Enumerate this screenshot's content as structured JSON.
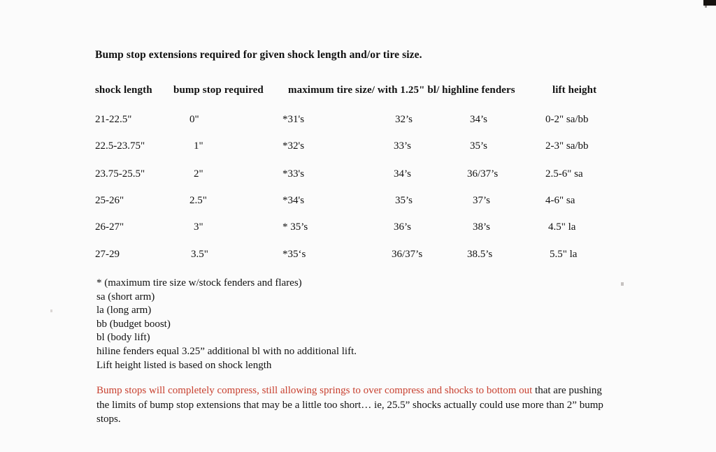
{
  "document": {
    "title": "Bump stop extensions required for given shock length and/or tire size."
  },
  "table": {
    "headers": [
      "shock length",
      "bump stop required",
      "maximum tire size/ with",
      "1.25\" bl/ highline fenders",
      "",
      "lift height"
    ],
    "header_display": {
      "col0": "shock length",
      "col1": "bump stop required",
      "col2": "maximum tire size/ with 1.25\" bl/ highline fenders",
      "col5": "lift height"
    },
    "rows": [
      {
        "shock_length": "21-22.5\"",
        "bump_stop": "0\"",
        "max_tire_stock": "*31's",
        "tire_with_bl": "32’s",
        "tire_highline": "34’s",
        "lift_height": "0-2\" sa/bb"
      },
      {
        "shock_length": "22.5-23.75\"",
        "bump_stop": "1\"",
        "max_tire_stock": "*32's",
        "tire_with_bl": "33’s",
        "tire_highline": "35’s",
        "lift_height": "2-3\" sa/bb"
      },
      {
        "shock_length": "23.75-25.5\"",
        "bump_stop": "2\"",
        "max_tire_stock": "*33's",
        "tire_with_bl": "34’s",
        "tire_highline": "36/37’s",
        "lift_height": "2.5-6\" sa"
      },
      {
        "shock_length": "25-26\"",
        "bump_stop": "2.5\"",
        "max_tire_stock": "*34's",
        "tire_with_bl": "35’s",
        "tire_highline": "37’s",
        "lift_height": "4-6\" sa"
      },
      {
        "shock_length": "26-27\"",
        "bump_stop": "3\"",
        "max_tire_stock": "* 35’s",
        "tire_with_bl": "36’s",
        "tire_highline": "38’s",
        "lift_height": "4.5\" la"
      },
      {
        "shock_length": "27-29",
        "bump_stop": "3.5\"",
        "max_tire_stock": "*35‘s",
        "tire_with_bl": "36/37’s",
        "tire_highline": "38.5’s",
        "lift_height": "5.5\" la"
      }
    ]
  },
  "legend": {
    "lines": [
      "* (maximum tire size w/stock fenders and flares)",
      "sa (short arm)",
      "la (long arm)",
      "bb (budget boost)",
      "bl (body lift)",
      "hiline fenders equal 3.25” additional bl with no additional lift.",
      "Lift height listed  is based on shock length"
    ]
  },
  "notice": {
    "red_text": "Bump stops will completely compress, still allowing springs to over compress and shocks to bottom out ",
    "black_text": "that are pushing the limits of bump stop extensions that may be a little too short… ie, 25.5” shocks actually could use more than 2”  bump stops.",
    "red_color": "#c8402f",
    "black_color": "#111111"
  }
}
